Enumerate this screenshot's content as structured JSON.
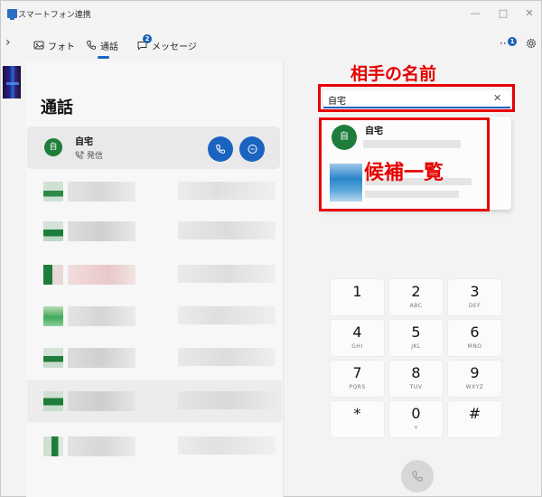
{
  "window": {
    "title": "スマートフォン連携"
  },
  "nav": {
    "tabs": [
      {
        "label": "フォト",
        "icon": "photo-icon"
      },
      {
        "label": "通話",
        "icon": "phone-icon",
        "active": true
      },
      {
        "label": "メッセージ",
        "icon": "message-icon",
        "badge": "2"
      }
    ],
    "notification_badge": "1"
  },
  "calls": {
    "title": "通話",
    "selected": {
      "avatar_letter": "自",
      "name": "自宅",
      "status": "発信"
    }
  },
  "dialer": {
    "search_value": "自宅",
    "suggestion": {
      "avatar_letter": "自",
      "name": "自宅"
    },
    "keys": [
      {
        "digit": "1",
        "letters": ""
      },
      {
        "digit": "2",
        "letters": "ABC"
      },
      {
        "digit": "3",
        "letters": "DEF"
      },
      {
        "digit": "4",
        "letters": "GHI"
      },
      {
        "digit": "5",
        "letters": "JKL"
      },
      {
        "digit": "6",
        "letters": "MNO"
      },
      {
        "digit": "7",
        "letters": "PQRS"
      },
      {
        "digit": "8",
        "letters": "TUV"
      },
      {
        "digit": "9",
        "letters": "WXYZ"
      },
      {
        "digit": "*",
        "letters": ""
      },
      {
        "digit": "0",
        "letters": "+"
      },
      {
        "digit": "#",
        "letters": ""
      }
    ]
  },
  "annotations": {
    "name_label": "相手の名前",
    "candidates_label": "候補一覧",
    "color": "#e60000"
  },
  "colors": {
    "accent": "#1a64c0",
    "avatar": "#1e7d3a"
  }
}
